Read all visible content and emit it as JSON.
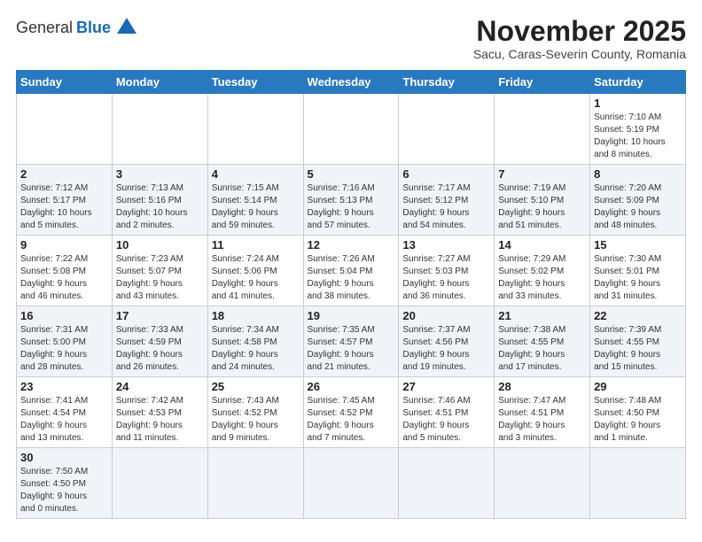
{
  "logo": {
    "text_general": "General",
    "text_blue": "Blue"
  },
  "header": {
    "title": "November 2025",
    "subtitle": "Sacu, Caras-Severin County, Romania"
  },
  "weekdays": [
    "Sunday",
    "Monday",
    "Tuesday",
    "Wednesday",
    "Thursday",
    "Friday",
    "Saturday"
  ],
  "weeks": [
    [
      {
        "day": "",
        "info": ""
      },
      {
        "day": "",
        "info": ""
      },
      {
        "day": "",
        "info": ""
      },
      {
        "day": "",
        "info": ""
      },
      {
        "day": "",
        "info": ""
      },
      {
        "day": "",
        "info": ""
      },
      {
        "day": "1",
        "info": "Sunrise: 7:10 AM\nSunset: 5:19 PM\nDaylight: 10 hours\nand 8 minutes."
      }
    ],
    [
      {
        "day": "2",
        "info": "Sunrise: 7:12 AM\nSunset: 5:17 PM\nDaylight: 10 hours\nand 5 minutes."
      },
      {
        "day": "3",
        "info": "Sunrise: 7:13 AM\nSunset: 5:16 PM\nDaylight: 10 hours\nand 2 minutes."
      },
      {
        "day": "4",
        "info": "Sunrise: 7:15 AM\nSunset: 5:14 PM\nDaylight: 9 hours\nand 59 minutes."
      },
      {
        "day": "5",
        "info": "Sunrise: 7:16 AM\nSunset: 5:13 PM\nDaylight: 9 hours\nand 57 minutes."
      },
      {
        "day": "6",
        "info": "Sunrise: 7:17 AM\nSunset: 5:12 PM\nDaylight: 9 hours\nand 54 minutes."
      },
      {
        "day": "7",
        "info": "Sunrise: 7:19 AM\nSunset: 5:10 PM\nDaylight: 9 hours\nand 51 minutes."
      },
      {
        "day": "8",
        "info": "Sunrise: 7:20 AM\nSunset: 5:09 PM\nDaylight: 9 hours\nand 48 minutes."
      }
    ],
    [
      {
        "day": "9",
        "info": "Sunrise: 7:22 AM\nSunset: 5:08 PM\nDaylight: 9 hours\nand 46 minutes."
      },
      {
        "day": "10",
        "info": "Sunrise: 7:23 AM\nSunset: 5:07 PM\nDaylight: 9 hours\nand 43 minutes."
      },
      {
        "day": "11",
        "info": "Sunrise: 7:24 AM\nSunset: 5:06 PM\nDaylight: 9 hours\nand 41 minutes."
      },
      {
        "day": "12",
        "info": "Sunrise: 7:26 AM\nSunset: 5:04 PM\nDaylight: 9 hours\nand 38 minutes."
      },
      {
        "day": "13",
        "info": "Sunrise: 7:27 AM\nSunset: 5:03 PM\nDaylight: 9 hours\nand 36 minutes."
      },
      {
        "day": "14",
        "info": "Sunrise: 7:29 AM\nSunset: 5:02 PM\nDaylight: 9 hours\nand 33 minutes."
      },
      {
        "day": "15",
        "info": "Sunrise: 7:30 AM\nSunset: 5:01 PM\nDaylight: 9 hours\nand 31 minutes."
      }
    ],
    [
      {
        "day": "16",
        "info": "Sunrise: 7:31 AM\nSunset: 5:00 PM\nDaylight: 9 hours\nand 28 minutes."
      },
      {
        "day": "17",
        "info": "Sunrise: 7:33 AM\nSunset: 4:59 PM\nDaylight: 9 hours\nand 26 minutes."
      },
      {
        "day": "18",
        "info": "Sunrise: 7:34 AM\nSunset: 4:58 PM\nDaylight: 9 hours\nand 24 minutes."
      },
      {
        "day": "19",
        "info": "Sunrise: 7:35 AM\nSunset: 4:57 PM\nDaylight: 9 hours\nand 21 minutes."
      },
      {
        "day": "20",
        "info": "Sunrise: 7:37 AM\nSunset: 4:56 PM\nDaylight: 9 hours\nand 19 minutes."
      },
      {
        "day": "21",
        "info": "Sunrise: 7:38 AM\nSunset: 4:55 PM\nDaylight: 9 hours\nand 17 minutes."
      },
      {
        "day": "22",
        "info": "Sunrise: 7:39 AM\nSunset: 4:55 PM\nDaylight: 9 hours\nand 15 minutes."
      }
    ],
    [
      {
        "day": "23",
        "info": "Sunrise: 7:41 AM\nSunset: 4:54 PM\nDaylight: 9 hours\nand 13 minutes."
      },
      {
        "day": "24",
        "info": "Sunrise: 7:42 AM\nSunset: 4:53 PM\nDaylight: 9 hours\nand 11 minutes."
      },
      {
        "day": "25",
        "info": "Sunrise: 7:43 AM\nSunset: 4:52 PM\nDaylight: 9 hours\nand 9 minutes."
      },
      {
        "day": "26",
        "info": "Sunrise: 7:45 AM\nSunset: 4:52 PM\nDaylight: 9 hours\nand 7 minutes."
      },
      {
        "day": "27",
        "info": "Sunrise: 7:46 AM\nSunset: 4:51 PM\nDaylight: 9 hours\nand 5 minutes."
      },
      {
        "day": "28",
        "info": "Sunrise: 7:47 AM\nSunset: 4:51 PM\nDaylight: 9 hours\nand 3 minutes."
      },
      {
        "day": "29",
        "info": "Sunrise: 7:48 AM\nSunset: 4:50 PM\nDaylight: 9 hours\nand 1 minute."
      }
    ],
    [
      {
        "day": "30",
        "info": "Sunrise: 7:50 AM\nSunset: 4:50 PM\nDaylight: 9 hours\nand 0 minutes."
      },
      {
        "day": "",
        "info": ""
      },
      {
        "day": "",
        "info": ""
      },
      {
        "day": "",
        "info": ""
      },
      {
        "day": "",
        "info": ""
      },
      {
        "day": "",
        "info": ""
      },
      {
        "day": "",
        "info": ""
      }
    ]
  ]
}
